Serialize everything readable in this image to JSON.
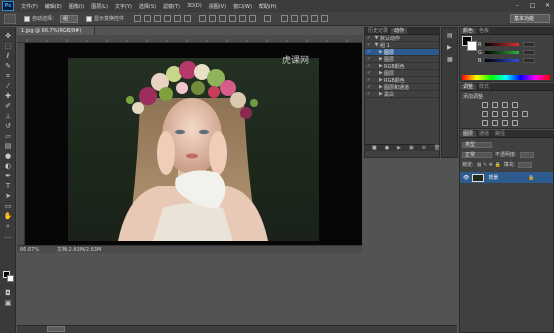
{
  "app": {
    "logo": "Ps"
  },
  "menu": [
    "文件(F)",
    "编辑(E)",
    "图像(I)",
    "图层(L)",
    "文字(Y)",
    "选择(S)",
    "滤镜(T)",
    "3D(D)",
    "视图(V)",
    "窗口(W)",
    "帮助(H)"
  ],
  "window_buttons": [
    "–",
    "□",
    "✕"
  ],
  "options": {
    "auto_select_label": "自动选择：",
    "layer_select": "组",
    "show_transform_label": "显示变换控件"
  },
  "workspace": {
    "label": "基本功能"
  },
  "document": {
    "tab_title": "1.jpg @ 66.7%(RGB/8#)",
    "zoom": "66.67%",
    "doc_info": "文档:2.63M/2.63M",
    "watermark": "虎课网"
  },
  "history_panel": {
    "tabs": [
      "历史记录",
      "动作"
    ],
    "rows": [
      {
        "label": "默认动作",
        "arrow": "▼"
      },
      {
        "label": "组 1",
        "arrow": "▼"
      },
      {
        "label": "图层",
        "arrow": "▶",
        "selected": true
      },
      {
        "label": "图层",
        "arrow": "▶"
      },
      {
        "label": "RGB颜色",
        "arrow": "▶"
      },
      {
        "label": "图层",
        "arrow": "▶"
      },
      {
        "label": "RGB颜色",
        "arrow": "▶"
      },
      {
        "label": "图层和通道",
        "arrow": "▶"
      },
      {
        "label": "黑白",
        "arrow": "▶"
      }
    ],
    "footer_icons": [
      "■",
      "●",
      "▶",
      "▣",
      "⊕",
      "🗑"
    ]
  },
  "color_panel": {
    "tabs": [
      "颜色",
      "色板"
    ],
    "channels": [
      {
        "ch": "R",
        "color": "#e03030"
      },
      {
        "ch": "G",
        "color": "#30b040"
      },
      {
        "ch": "B",
        "color": "#3050e0"
      }
    ]
  },
  "adjustments_panel": {
    "tabs": [
      "调整",
      "样式"
    ],
    "title": "添加调整"
  },
  "layers_panel": {
    "tabs": [
      "图层",
      "通道",
      "路径"
    ],
    "kind_filter": "类型",
    "blend_mode": "正常",
    "opacity_label": "不透明度:",
    "lock_label": "锁定:",
    "fill_label": "填充:",
    "layer_name": "背景"
  }
}
